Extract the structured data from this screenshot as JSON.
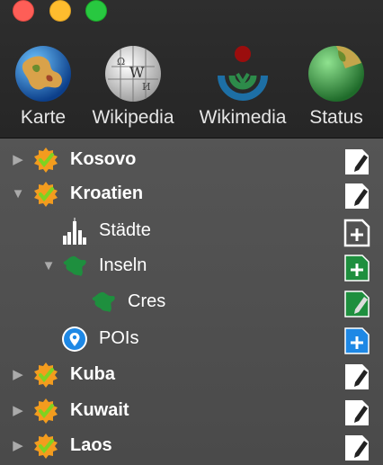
{
  "toolbar": {
    "buttons": [
      {
        "label": "Karte",
        "icon": "globe-map-icon"
      },
      {
        "label": "Wikipedia",
        "icon": "wikipedia-globe-icon"
      },
      {
        "label": "Wikimedia",
        "icon": "wikimedia-logo-icon"
      },
      {
        "label": "Status",
        "icon": "status-globe-icon"
      }
    ]
  },
  "tree": {
    "rows": [
      {
        "label": "Kosovo",
        "expanded": false,
        "icon": "verified-badge-icon",
        "action": "edit-document-icon"
      },
      {
        "label": "Kroatien",
        "expanded": true,
        "icon": "verified-badge-icon",
        "action": "edit-document-icon"
      },
      {
        "label": "Städte",
        "icon": "city-skyline-icon",
        "action": "add-document-icon"
      },
      {
        "label": "Inseln",
        "expanded": true,
        "icon": "island-icon",
        "action": "add-document-green-icon"
      },
      {
        "label": "Cres",
        "icon": "island-icon",
        "action": "edit-document-green-icon"
      },
      {
        "label": "POIs",
        "icon": "map-pin-icon",
        "action": "add-document-blue-icon"
      },
      {
        "label": "Kuba",
        "expanded": false,
        "icon": "verified-badge-icon",
        "action": "edit-document-icon"
      },
      {
        "label": "Kuwait",
        "expanded": false,
        "icon": "verified-badge-icon",
        "action": "edit-document-icon"
      },
      {
        "label": "Laos",
        "expanded": false,
        "icon": "verified-badge-icon",
        "action": "edit-document-icon"
      }
    ]
  },
  "colors": {
    "badge_orange": "#f39c1e",
    "check_green": "#7ed321",
    "island_green": "#1e8f3e",
    "pin_blue": "#1e88e5",
    "close": "#fe5e57",
    "minimize": "#febc2e",
    "maximize": "#28c840"
  }
}
